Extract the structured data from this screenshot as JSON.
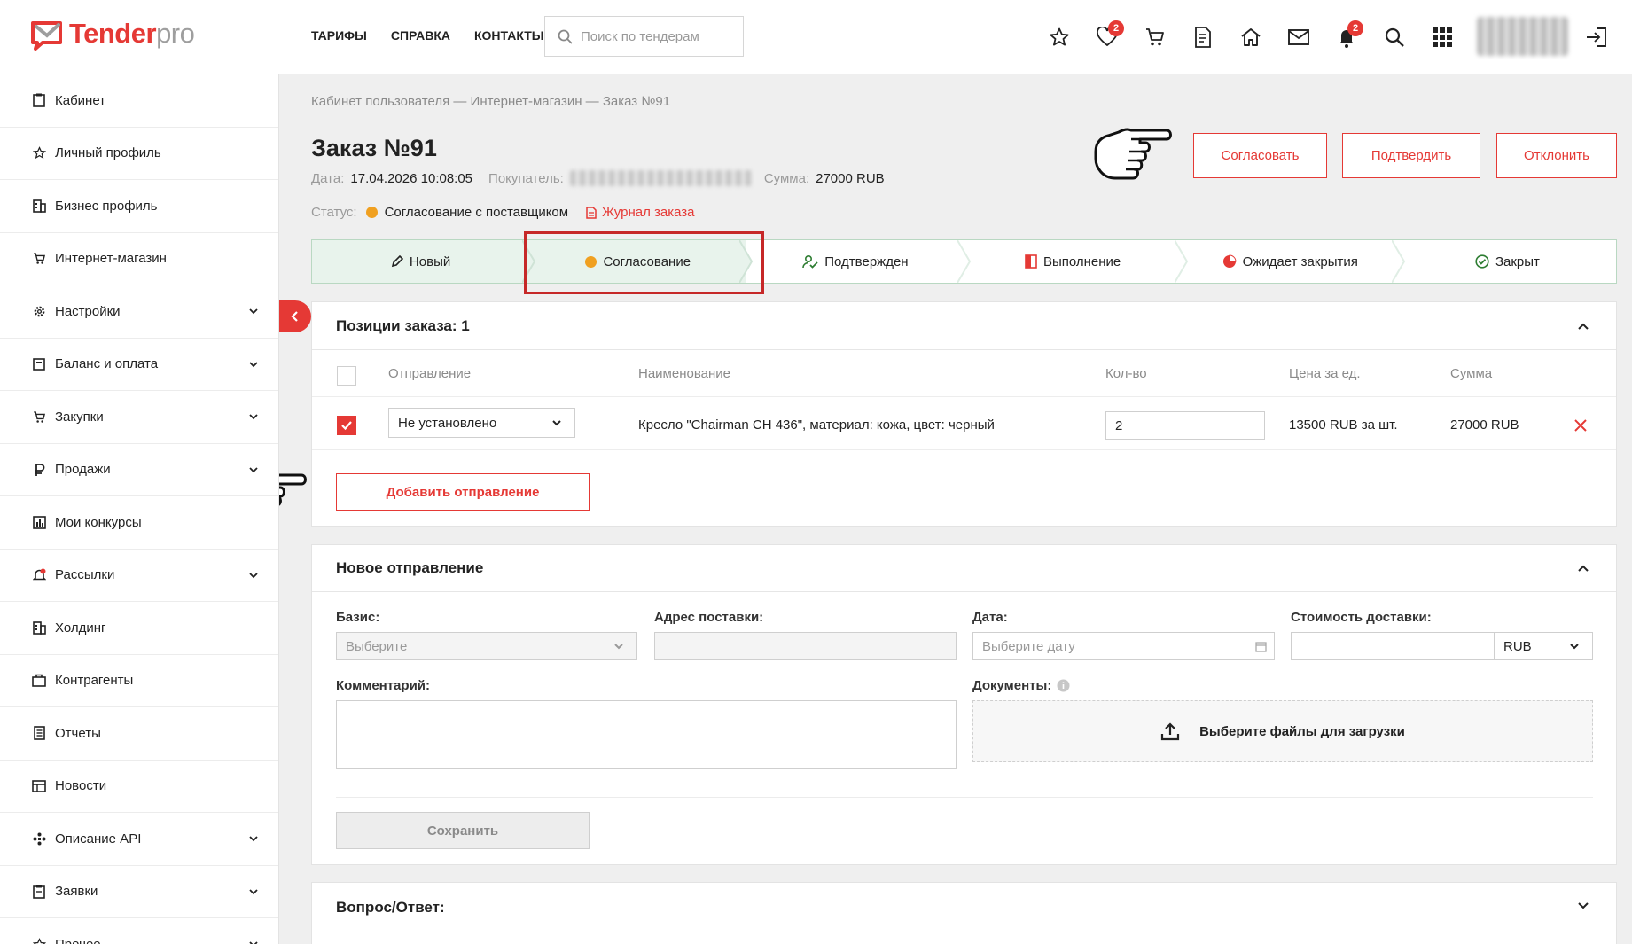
{
  "header": {
    "logo_main": "Tender",
    "logo_suffix": "pro",
    "nav": [
      "ТАРИФЫ",
      "СПРАВКА",
      "КОНТАКТЫ"
    ],
    "search_placeholder": "Поиск по тендерам",
    "favorites_badge": "2",
    "notifications_badge": "2",
    "icons": [
      "star-icon",
      "heart-icon",
      "cart-icon",
      "document-icon",
      "home-icon",
      "mail-icon",
      "bell-icon",
      "search-icon",
      "apps-grid-icon",
      "logout-icon"
    ]
  },
  "sidebar": {
    "items": [
      {
        "label": "Кабинет",
        "icon": "cabinet-icon"
      },
      {
        "label": "Личный профиль",
        "icon": "star-icon"
      },
      {
        "label": "Бизнес профиль",
        "icon": "building-icon"
      },
      {
        "label": "Интернет-магазин",
        "icon": "cart-icon"
      },
      {
        "label": "Настройки",
        "icon": "gear-icon"
      },
      {
        "label": "Баланс и оплата",
        "icon": "wallet-icon"
      },
      {
        "label": "Закупки",
        "icon": "cart-icon"
      },
      {
        "label": "Продажи",
        "icon": "ruble-icon"
      },
      {
        "label": "Мои конкурсы",
        "icon": "chart-icon"
      },
      {
        "label": "Рассылки",
        "icon": "bell-icon"
      },
      {
        "label": "Холдинг",
        "icon": "building-icon"
      },
      {
        "label": "Контрагенты",
        "icon": "briefcase-icon"
      },
      {
        "label": "Отчеты",
        "icon": "report-icon"
      },
      {
        "label": "Новости",
        "icon": "news-icon"
      },
      {
        "label": "Описание API",
        "icon": "api-icon"
      },
      {
        "label": "Заявки",
        "icon": "clipboard-icon"
      },
      {
        "label": "Прочее",
        "icon": "star-icon"
      }
    ]
  },
  "page": {
    "breadcrumb": "Кабинет пользователя — Интернет-магазин —  Заказ №91",
    "title": "Заказ №91",
    "date_label": "Дата:",
    "date_value": "17.04.2026 10:08:05",
    "buyer_label": "Покупатель:",
    "sum_label": "Сумма:",
    "sum_value": "27000 RUB",
    "status_label": "Статус:",
    "status_value": "Согласование с поставщиком",
    "status_color": "#f0a020",
    "journal_link": "Журнал заказа",
    "accent_color": "#e53935"
  },
  "actions": {
    "approve": "Согласовать",
    "confirm": "Подтвердить",
    "reject": "Отклонить"
  },
  "steps": [
    {
      "label": "Новый",
      "icon": "pencil-icon",
      "state": "done"
    },
    {
      "label": "Согласование",
      "icon": "clock-icon",
      "state": "current"
    },
    {
      "label": "Подтвержден",
      "icon": "user-check-icon",
      "state": "todo"
    },
    {
      "label": "Выполнение",
      "icon": "progress-icon",
      "state": "todo"
    },
    {
      "label": "Ожидает закрытия",
      "icon": "pie-icon",
      "state": "todo"
    },
    {
      "label": "Закрыт",
      "icon": "check-circle-icon",
      "state": "todo"
    }
  ],
  "positions": {
    "title": "Позиции заказа: 1",
    "columns": [
      "Отправление",
      "Наименование",
      "Кол-во",
      "Цена за ед.",
      "Сумма"
    ],
    "row": {
      "shipment": "Не установлено",
      "name": "Кресло \"Chairman CH 436\", материал: кожа, цвет: черный",
      "qty": "2",
      "price": "13500 RUB за шт.",
      "sum": "27000 RUB"
    },
    "add_shipment": "Добавить отправление"
  },
  "new_shipment": {
    "title": "Новое отправление",
    "basis_label": "Базис:",
    "basis_placeholder": "Выберите",
    "address_label": "Адрес поставки:",
    "date_label": "Дата:",
    "date_placeholder": "Выберите дату",
    "cost_label": "Стоимость доставки:",
    "currency": "RUB",
    "comment_label": "Комментарий:",
    "docs_label": "Документы:",
    "upload_text": "Выберите файлы для загрузки",
    "save": "Сохранить"
  },
  "qa": {
    "title": "Вопрос/Ответ:"
  }
}
